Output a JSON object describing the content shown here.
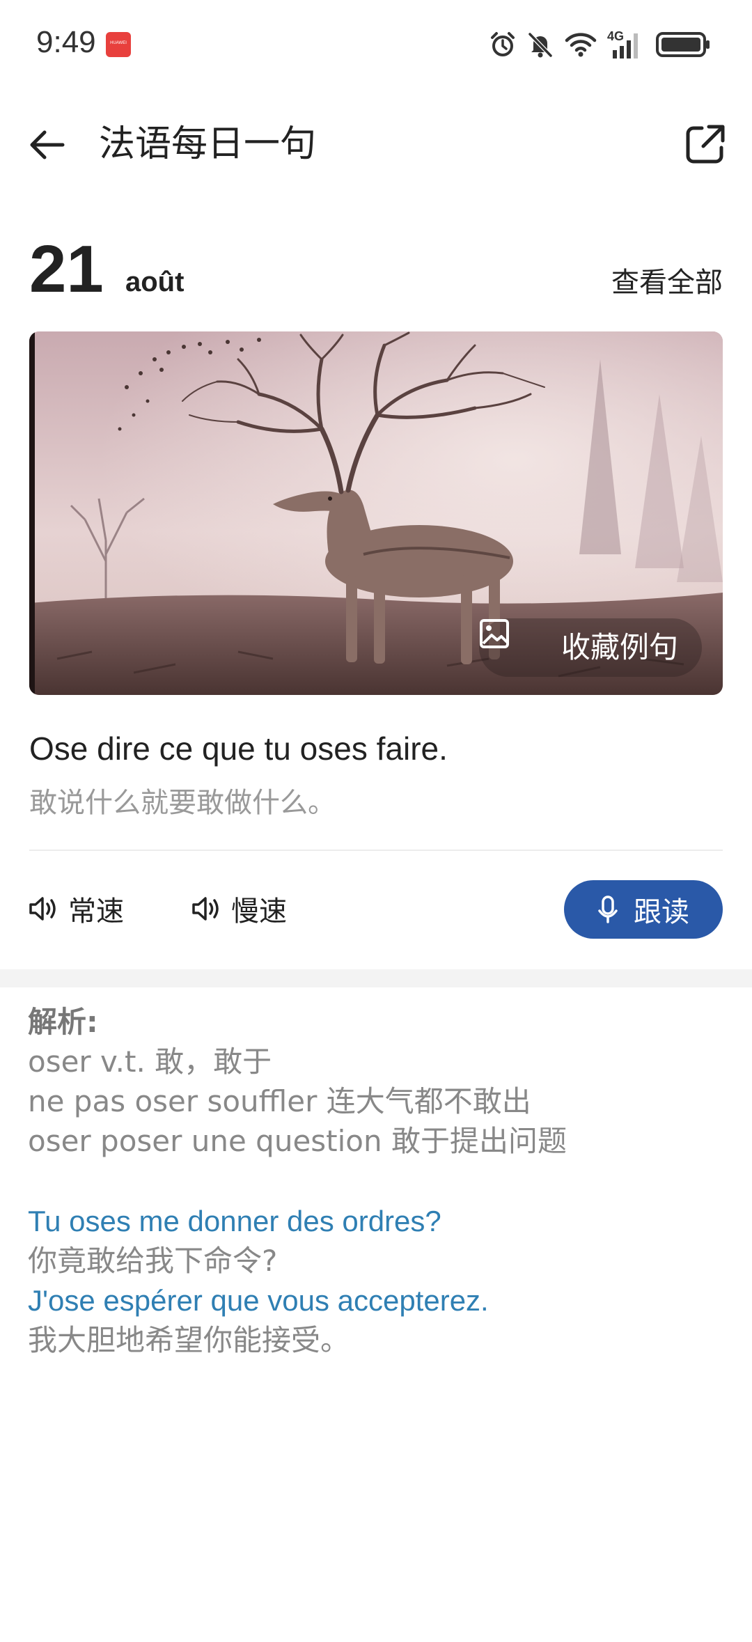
{
  "status_bar": {
    "time": "9:49",
    "app_badge_text": "HUAWEI",
    "network": "4G",
    "icons": [
      "alarm-icon",
      "mute-icon",
      "wifi-icon",
      "signal-icon",
      "battery-icon"
    ]
  },
  "header": {
    "title": "法语每日一句",
    "back_icon": "back-arrow-icon",
    "share_icon": "share-icon"
  },
  "date": {
    "day": "21",
    "month": "août",
    "view_all_label": "查看全部"
  },
  "hero": {
    "image_description_icon": "image-icon",
    "collect_label": "收藏例句"
  },
  "sentence": {
    "french": "Ose dire ce que tu oses faire.",
    "chinese": "敢说什么就要敢做什么。"
  },
  "audio": {
    "normal_label": "常速",
    "slow_label": "慢速",
    "follow_read_label": "跟读"
  },
  "analysis": {
    "title": "解析:",
    "lines": [
      "oser v.t. 敢，敢于",
      "ne pas oser souffler 连大气都不敢出",
      "oser poser une question 敢于提出问题"
    ],
    "examples": [
      {
        "french": "Tu oses me donner des ordres?",
        "chinese": "你竟敢给我下命令?"
      },
      {
        "french": "J'ose espérer que vous accepterez.",
        "chinese": "我大胆地希望你能接受。"
      }
    ]
  },
  "colors": {
    "accent_button": "#2a59a8",
    "example_blue": "#2f7fb3",
    "muted_text": "#888888"
  }
}
